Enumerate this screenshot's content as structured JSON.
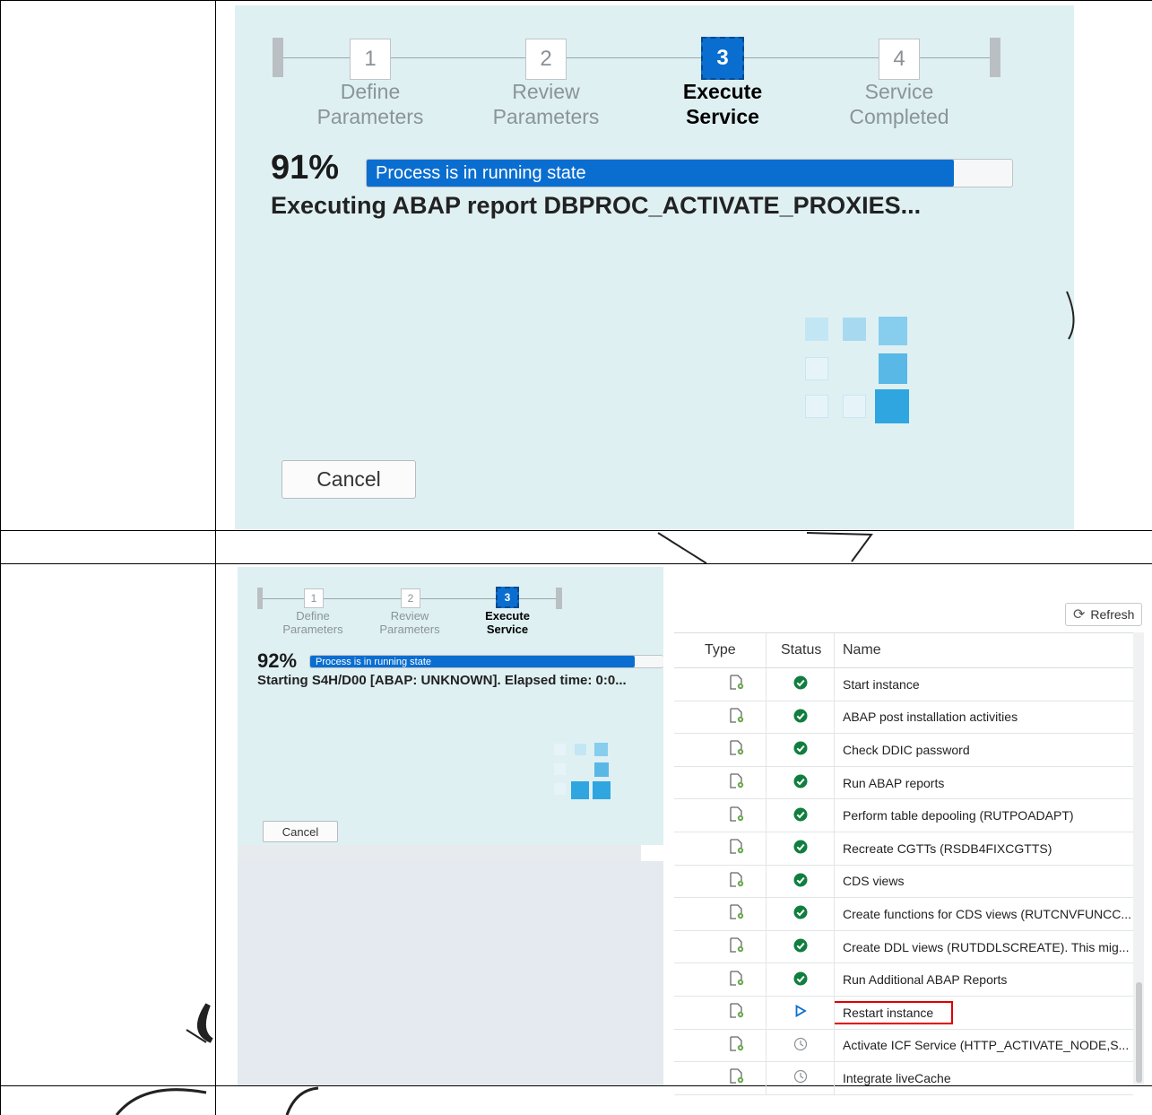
{
  "panel_top": {
    "steps": [
      {
        "num": "1",
        "label_line1": "Define",
        "label_line2": "Parameters",
        "active": false
      },
      {
        "num": "2",
        "label_line1": "Review",
        "label_line2": "Parameters",
        "active": false
      },
      {
        "num": "3",
        "label_line1": "Execute",
        "label_line2": "Service",
        "active": true
      },
      {
        "num": "4",
        "label_line1": "Service",
        "label_line2": "Completed",
        "active": false
      }
    ],
    "progress_percent_label": "91%",
    "progress_fraction": 0.91,
    "progress_status": "Process is in running state",
    "executing_text": "Executing ABAP report DBPROC_ACTIVATE_PROXIES...",
    "cancel_label": "Cancel"
  },
  "panel_bottom": {
    "steps": [
      {
        "num": "1",
        "label_line1": "Define",
        "label_line2": "Parameters",
        "active": false
      },
      {
        "num": "2",
        "label_line1": "Review",
        "label_line2": "Parameters",
        "active": false
      },
      {
        "num": "3",
        "label_line1": "Execute",
        "label_line2": "Service",
        "active": true
      }
    ],
    "progress_percent_label": "92%",
    "progress_fraction": 0.92,
    "progress_status": "Process is in running state",
    "executing_text": "Starting S4H/D00 [ABAP: UNKNOWN]. Elapsed time: 0:0...",
    "cancel_label": "Cancel"
  },
  "task_table": {
    "refresh_label": "Refresh",
    "columns": {
      "type": "Type",
      "status": "Status",
      "name": "Name"
    },
    "rows": [
      {
        "status": "done",
        "name": "Start instance"
      },
      {
        "status": "done",
        "name": "ABAP post installation activities"
      },
      {
        "status": "done",
        "name": "Check DDIC password"
      },
      {
        "status": "done",
        "name": "Run ABAP reports"
      },
      {
        "status": "done",
        "name": "Perform table depooling (RUTPOADAPT)"
      },
      {
        "status": "done",
        "name": "Recreate CGTTs (RSDB4FIXCGTTS)"
      },
      {
        "status": "done",
        "name": "CDS views"
      },
      {
        "status": "done",
        "name": "Create functions for CDS views (RUTCNVFUNCC..."
      },
      {
        "status": "done",
        "name": "Create DDL views (RUTDDLSCREATE). This mig..."
      },
      {
        "status": "done",
        "name": "Run Additional ABAP Reports"
      },
      {
        "status": "running",
        "name": "Restart instance"
      },
      {
        "status": "pending",
        "name": "Activate ICF Service (HTTP_ACTIVATE_NODE,S..."
      },
      {
        "status": "pending",
        "name": "Integrate liveCache"
      }
    ]
  },
  "colors": {
    "accent": "#0a6ed1",
    "panel_bg": "#dff0f3",
    "success": "#107e3e",
    "highlight": "#e00000"
  },
  "icons": {
    "type": "document-gear-icon",
    "done": "check-circle-icon",
    "running": "play-triangle-icon",
    "pending": "clock-icon",
    "refresh": "refresh-icon"
  }
}
